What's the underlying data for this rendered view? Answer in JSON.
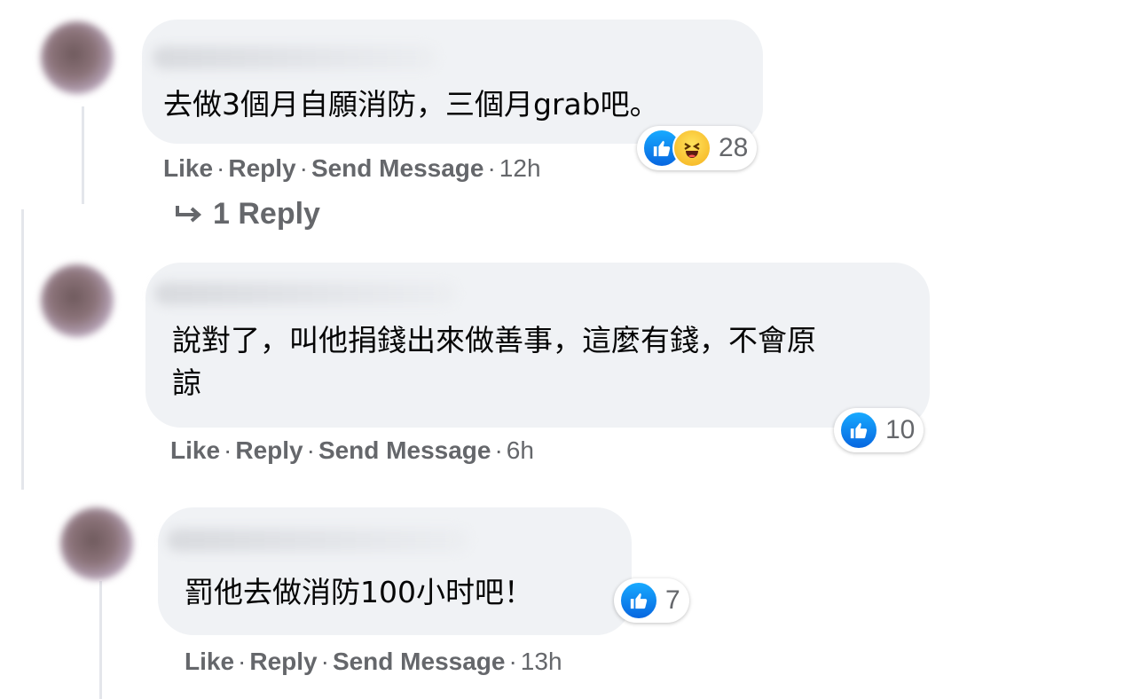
{
  "comments": [
    {
      "text": "去做3個月自願消防，三個月grab吧。",
      "actions": {
        "like": "Like",
        "reply": "Reply",
        "send": "Send Message",
        "time": "12h"
      },
      "reactions": {
        "icons": [
          "like-icon",
          "haha-icon"
        ],
        "count": "28"
      },
      "replies_link": "1 Reply"
    },
    {
      "text": "說對了，叫他捐錢出來做善事，這麼有錢，不會原\n諒",
      "actions": {
        "like": "Like",
        "reply": "Reply",
        "send": "Send Message",
        "time": "6h"
      },
      "reactions": {
        "icons": [
          "like-icon"
        ],
        "count": "10"
      }
    },
    {
      "text": "罰他去做消防100小时吧！",
      "actions": {
        "like": "Like",
        "reply": "Reply",
        "send": "Send Message",
        "time": "13h"
      },
      "reactions": {
        "icons": [
          "like-icon"
        ],
        "count": "7"
      }
    }
  ],
  "separator": "·",
  "colors": {
    "bubble": "#f0f2f5",
    "meta": "#65676b",
    "like": "#1877f2"
  }
}
